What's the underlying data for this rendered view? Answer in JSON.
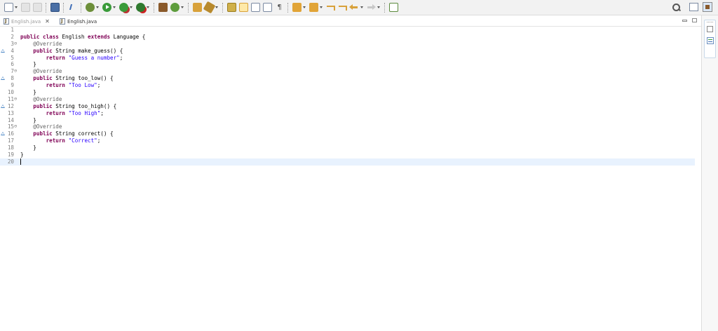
{
  "toolbar": {
    "left_icons": [
      "new-wizard-icon",
      "save-disabled-icon",
      "save-all-disabled-icon",
      "save-icon",
      "skip-breakpoints-icon",
      "debug-icon",
      "run-icon",
      "coverage-icon",
      "external-tools-icon",
      "new-package-icon",
      "new-class-icon",
      "open-type-icon",
      "search-icon",
      "toggle-mark-occurrences-icon",
      "toggle-block-selection-icon",
      "show-whitespace-icon",
      "next-annotation-icon",
      "previous-annotation-icon",
      "last-edit-location-icon",
      "back-icon",
      "forward-icon",
      "pin-editor-icon"
    ],
    "right_icons": [
      "search-tool-icon",
      "open-perspective-icon",
      "java-perspective-icon"
    ]
  },
  "tabs": [
    {
      "label": "English.java",
      "close": "✕",
      "state": "inactive"
    },
    {
      "label": "English.java",
      "state": "active"
    }
  ],
  "editor": {
    "lines": [
      {
        "num": "1",
        "segments": []
      },
      {
        "num": "2",
        "segments": [
          {
            "t": "public",
            "c": "kw"
          },
          {
            "t": " "
          },
          {
            "t": "class",
            "c": "kw"
          },
          {
            "t": " English "
          },
          {
            "t": "extends",
            "c": "kw"
          },
          {
            "t": " Language {"
          }
        ]
      },
      {
        "num": "3",
        "fold": "⊖",
        "segments": [
          {
            "t": "    "
          },
          {
            "t": "@Override",
            "c": "ann"
          }
        ]
      },
      {
        "num": "4",
        "override": true,
        "segments": [
          {
            "t": "    "
          },
          {
            "t": "public",
            "c": "kw"
          },
          {
            "t": " String make_guess() {"
          }
        ]
      },
      {
        "num": "5",
        "segments": [
          {
            "t": "        "
          },
          {
            "t": "return",
            "c": "kw"
          },
          {
            "t": " "
          },
          {
            "t": "\"Guess a number\"",
            "c": "str"
          },
          {
            "t": ";"
          }
        ]
      },
      {
        "num": "6",
        "segments": [
          {
            "t": "    }"
          }
        ]
      },
      {
        "num": "7",
        "fold": "⊖",
        "segments": [
          {
            "t": "    "
          },
          {
            "t": "@Override",
            "c": "ann"
          }
        ]
      },
      {
        "num": "8",
        "override": true,
        "segments": [
          {
            "t": "    "
          },
          {
            "t": "public",
            "c": "kw"
          },
          {
            "t": " String too_low() {"
          }
        ]
      },
      {
        "num": "9",
        "segments": [
          {
            "t": "        "
          },
          {
            "t": "return",
            "c": "kw"
          },
          {
            "t": " "
          },
          {
            "t": "\"Too Low\"",
            "c": "str"
          },
          {
            "t": ";"
          }
        ]
      },
      {
        "num": "10",
        "segments": [
          {
            "t": "    }"
          }
        ]
      },
      {
        "num": "11",
        "fold": "⊖",
        "segments": [
          {
            "t": "    "
          },
          {
            "t": "@Override",
            "c": "ann"
          }
        ]
      },
      {
        "num": "12",
        "override": true,
        "segments": [
          {
            "t": "    "
          },
          {
            "t": "public",
            "c": "kw"
          },
          {
            "t": " String too_high() {"
          }
        ]
      },
      {
        "num": "13",
        "segments": [
          {
            "t": "        "
          },
          {
            "t": "return",
            "c": "kw"
          },
          {
            "t": " "
          },
          {
            "t": "\"Too High\"",
            "c": "str"
          },
          {
            "t": ";"
          }
        ]
      },
      {
        "num": "14",
        "segments": [
          {
            "t": "    }"
          }
        ]
      },
      {
        "num": "15",
        "fold": "⊖",
        "segments": [
          {
            "t": "    "
          },
          {
            "t": "@Override",
            "c": "ann"
          }
        ]
      },
      {
        "num": "16",
        "override": true,
        "segments": [
          {
            "t": "    "
          },
          {
            "t": "public",
            "c": "kw"
          },
          {
            "t": " String correct() {"
          }
        ]
      },
      {
        "num": "17",
        "segments": [
          {
            "t": "        "
          },
          {
            "t": "return",
            "c": "kw"
          },
          {
            "t": " "
          },
          {
            "t": "\"Correct\"",
            "c": "str"
          },
          {
            "t": ";"
          }
        ]
      },
      {
        "num": "18",
        "segments": [
          {
            "t": "    }"
          }
        ]
      },
      {
        "num": "19",
        "segments": [
          {
            "t": "}"
          }
        ]
      },
      {
        "num": "20",
        "current": true,
        "segments": []
      }
    ]
  },
  "colors": {
    "keyword": "#7f0055",
    "annotation": "#646464",
    "string": "#2a00ff",
    "current_line": "#e8f2fe",
    "line_number": "#7f7f7f"
  }
}
